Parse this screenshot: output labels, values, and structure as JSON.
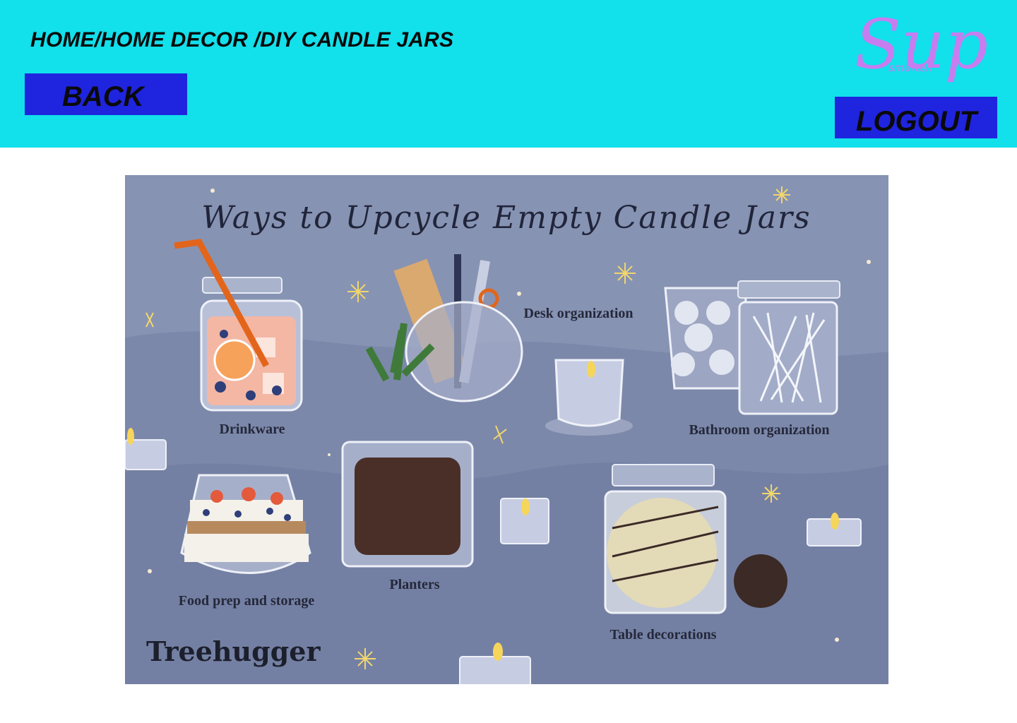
{
  "header": {
    "breadcrumb": "HOME/HOME DECOR /DIY CANDLE JARS",
    "back_label": "BACK",
    "logout_label": "LOGOUT",
    "logo_text": "Sup",
    "logo_subtext": "smarten"
  },
  "illustration": {
    "title": "Ways to Upcycle Empty Candle Jars",
    "captions": {
      "drinkware": "Drinkware",
      "desk": "Desk organization",
      "bathroom": "Bathroom organization",
      "food": "Food prep and storage",
      "planters": "Planters",
      "table": "Table decorations"
    },
    "brand": "Treehugger"
  },
  "colors": {
    "header_bg": "#12e0eb",
    "button_bg": "#1f24df",
    "logo": "#c77df0",
    "illustration_bg": "#8793b3"
  }
}
